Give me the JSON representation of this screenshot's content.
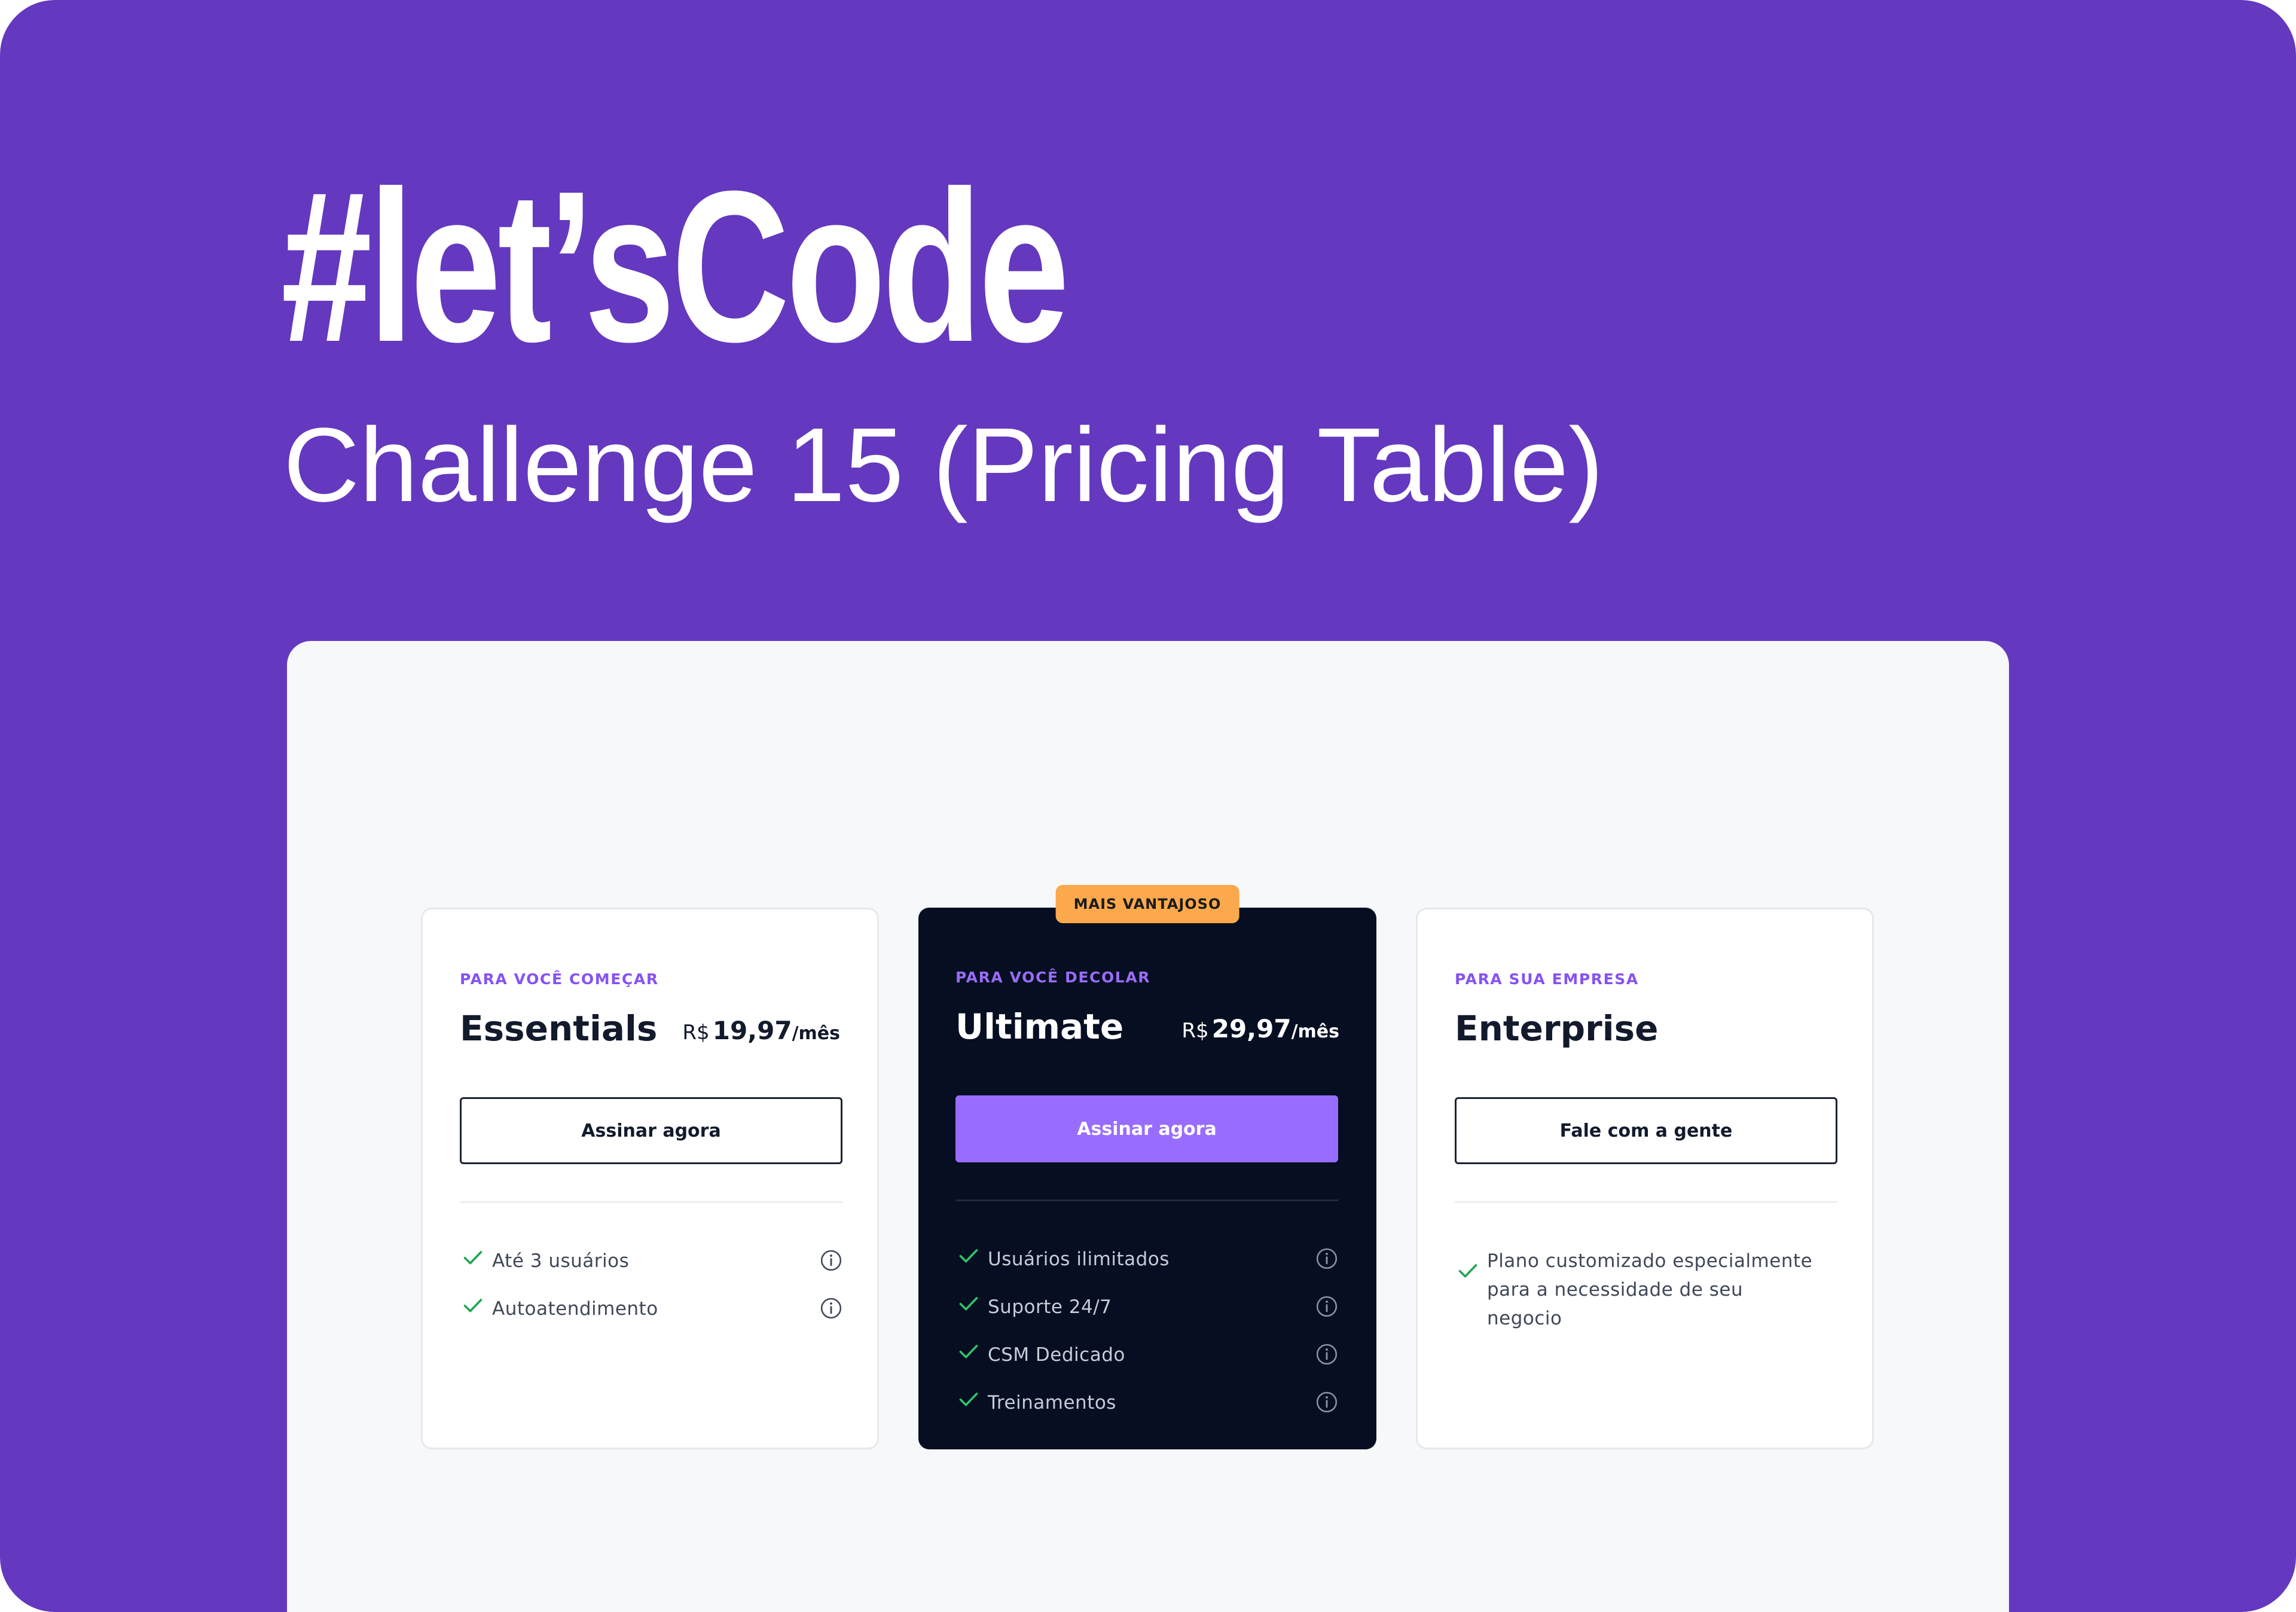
{
  "hero": {
    "title": "#let’sCode",
    "subtitle": "Challenge 15 (Pricing Table)"
  },
  "colors": {
    "banner": "#6438bf",
    "panel": "#f7f8fa",
    "accent": "#8652f3",
    "dark_card": "#060f22",
    "badge": "#fba94c",
    "check": "#1fa652"
  },
  "plans": [
    {
      "eyebrow": "PARA VOCÊ COMEÇAR",
      "name": "Essentials",
      "price_currency": "R$",
      "price_amount": "19,97",
      "price_period": "/mês",
      "cta": "Assinar agora",
      "features": [
        {
          "text": "Até 3 usuários",
          "icon": "check-icon",
          "info_icon": "info-icon"
        },
        {
          "text": "Autoatendimento",
          "icon": "check-icon",
          "info_icon": "info-icon"
        }
      ]
    },
    {
      "badge": "MAIS VANTAJOSO",
      "eyebrow": "PARA VOCÊ DECOLAR",
      "name": "Ultimate",
      "price_currency": "R$",
      "price_amount": "29,97",
      "price_period": "/mês",
      "cta": "Assinar agora",
      "features": [
        {
          "text": "Usuários ilimitados",
          "icon": "check-icon",
          "info_icon": "info-icon"
        },
        {
          "text": "Suporte 24/7",
          "icon": "check-icon",
          "info_icon": "info-icon"
        },
        {
          "text": "CSM Dedicado",
          "icon": "check-icon",
          "info_icon": "info-icon"
        },
        {
          "text": "Treinamentos",
          "icon": "check-icon",
          "info_icon": "info-icon"
        }
      ]
    },
    {
      "eyebrow": "PARA SUA EMPRESA",
      "name": "Enterprise",
      "cta": "Fale com a gente",
      "features": [
        {
          "text": "Plano customizado especialmente para a necessidade de seu negocio",
          "icon": "check-icon"
        }
      ]
    }
  ]
}
